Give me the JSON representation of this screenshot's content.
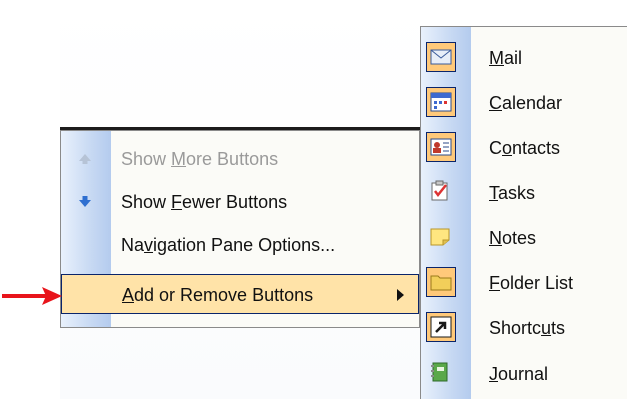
{
  "left_menu": {
    "items": [
      {
        "label": "Show More Buttons",
        "state": "disabled",
        "icon": "arrow-up-icon"
      },
      {
        "label": "Show Fewer Buttons",
        "state": "enabled",
        "icon": "arrow-down-icon"
      },
      {
        "label": "Navigation Pane Options...",
        "state": "enabled",
        "icon": ""
      },
      {
        "label": "Add or Remove Buttons",
        "state": "highlighted",
        "icon": "",
        "has_submenu": true
      }
    ]
  },
  "submenu": {
    "items": [
      {
        "label": "Mail",
        "icon": "mail-icon",
        "checked": true
      },
      {
        "label": "Calendar",
        "icon": "calendar-icon",
        "checked": true
      },
      {
        "label": "Contacts",
        "icon": "contacts-icon",
        "checked": true
      },
      {
        "label": "Tasks",
        "icon": "tasks-icon",
        "checked": false
      },
      {
        "label": "Notes",
        "icon": "notes-icon",
        "checked": false
      },
      {
        "label": "Folder List",
        "icon": "folder-list-icon",
        "checked": true
      },
      {
        "label": "Shortcuts",
        "icon": "shortcuts-icon",
        "checked": true
      },
      {
        "label": "Journal",
        "icon": "journal-icon",
        "checked": false
      }
    ]
  },
  "colors": {
    "highlight_bg": "#ffe3a8",
    "highlight_border": "#0a246a",
    "checked_icon_bg": "#ffc97a",
    "pointer_arrow": "#e8141b"
  }
}
